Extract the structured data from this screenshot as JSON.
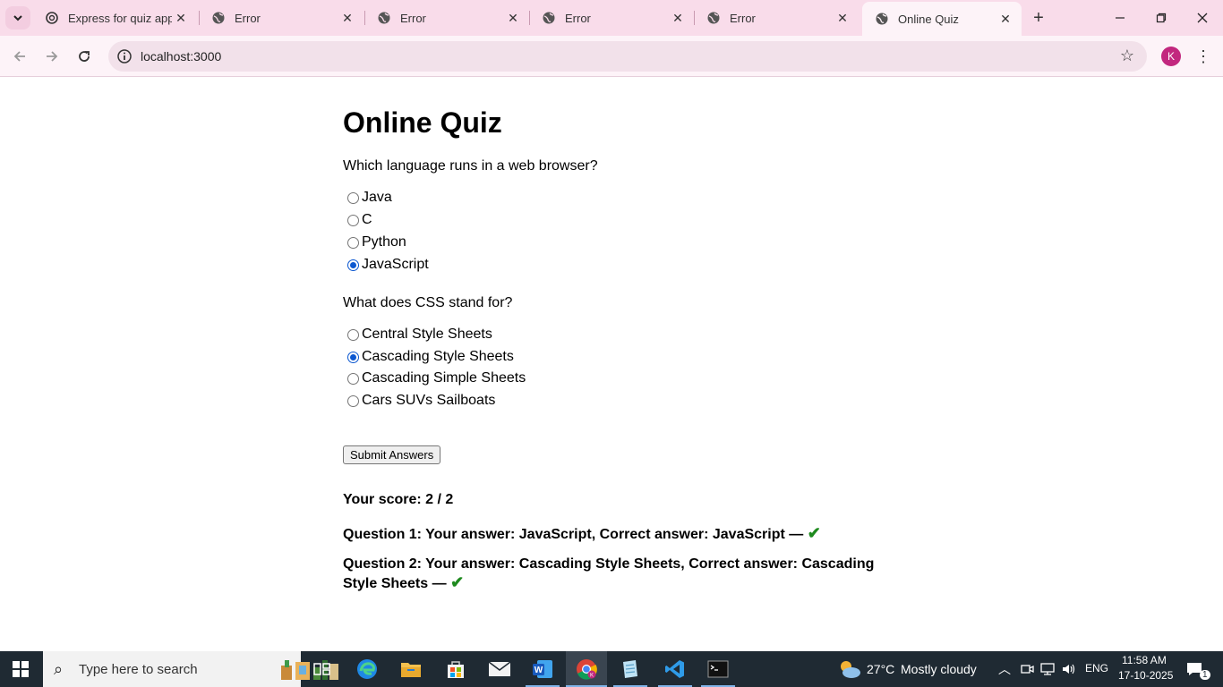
{
  "browser": {
    "tabs": [
      {
        "title": "Express for quiz app",
        "icon": "openai-icon",
        "active": false
      },
      {
        "title": "Error",
        "icon": "globe-icon",
        "active": false
      },
      {
        "title": "Error",
        "icon": "globe-icon",
        "active": false
      },
      {
        "title": "Error",
        "icon": "globe-icon",
        "active": false
      },
      {
        "title": "Error",
        "icon": "globe-icon",
        "active": false
      },
      {
        "title": "Online Quiz",
        "icon": "globe-icon",
        "active": true
      }
    ],
    "url": "localhost:3000",
    "profile_initial": "K",
    "accent_color": "#f9dcea"
  },
  "quiz": {
    "title": "Online Quiz",
    "questions": [
      {
        "text": "Which language runs in a web browser?",
        "options": [
          "Java",
          "C",
          "Python",
          "JavaScript"
        ],
        "selected": "JavaScript"
      },
      {
        "text": "What does CSS stand for?",
        "options": [
          "Central Style Sheets",
          "Cascading Style Sheets",
          "Cascading Simple Sheets",
          "Cars SUVs Sailboats"
        ],
        "selected": "Cascading Style Sheets"
      }
    ],
    "submit_label": "Submit Answers",
    "score_text": "Your score: 2 / 2",
    "results": [
      {
        "text": "Question 1: Your answer: JavaScript, Correct answer: JavaScript —",
        "status_icon": "check-icon"
      },
      {
        "text": "Question 2: Your answer: Cascading Style Sheets, Correct answer: Cascading Style Sheets —",
        "status_icon": "check-icon"
      }
    ],
    "check_glyph": "✔",
    "check_color": "#1e8a1e"
  },
  "taskbar": {
    "search_placeholder": "Type here to search",
    "weather_temp": "27°C",
    "weather_desc": "Mostly cloudy",
    "language": "ENG",
    "time": "11:58 AM",
    "date": "17-10-2025",
    "notification_count": "1",
    "pinned_icons": [
      "task-view-icon",
      "edge-icon",
      "file-explorer-icon",
      "store-icon",
      "mail-icon",
      "word-icon",
      "chrome-icon",
      "notepad-icon",
      "vscode-icon",
      "terminal-icon"
    ]
  }
}
